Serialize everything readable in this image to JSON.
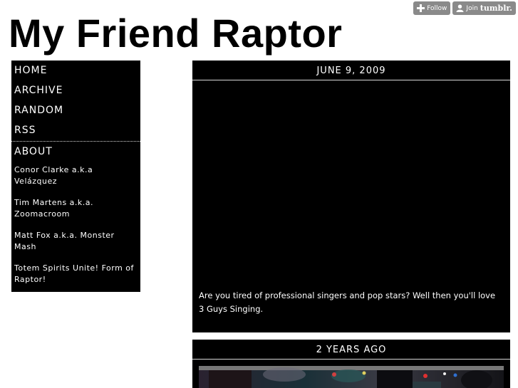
{
  "tumblr_controls": {
    "follow_label": "Follow",
    "join_label": "Join",
    "brand": "tumblr."
  },
  "site": {
    "title": "My Friend Raptor"
  },
  "nav": {
    "items": [
      {
        "label": "HOME"
      },
      {
        "label": "ARCHIVE"
      },
      {
        "label": "RANDOM"
      },
      {
        "label": "RSS"
      }
    ]
  },
  "about": {
    "title": "ABOUT",
    "links": [
      {
        "label": "Conor Clarke a.k.a Velázquez"
      },
      {
        "label": "Tim Martens a.k.a. Zoomacroom"
      },
      {
        "label": "Matt Fox a.k.a. Monster Mash"
      },
      {
        "label": "Totem Spirits Unite! Form of Raptor!"
      }
    ]
  },
  "posts": [
    {
      "date": "JUNE 9, 2009",
      "caption": "Are you tired of professional singers and pop stars? Well then you'll love 3 Guys Singing."
    },
    {
      "date": "2 YEARS AGO"
    }
  ],
  "colors": {
    "panel": "#000000",
    "page": "#ffffff",
    "tumblr_button": "#8a8a8a"
  }
}
